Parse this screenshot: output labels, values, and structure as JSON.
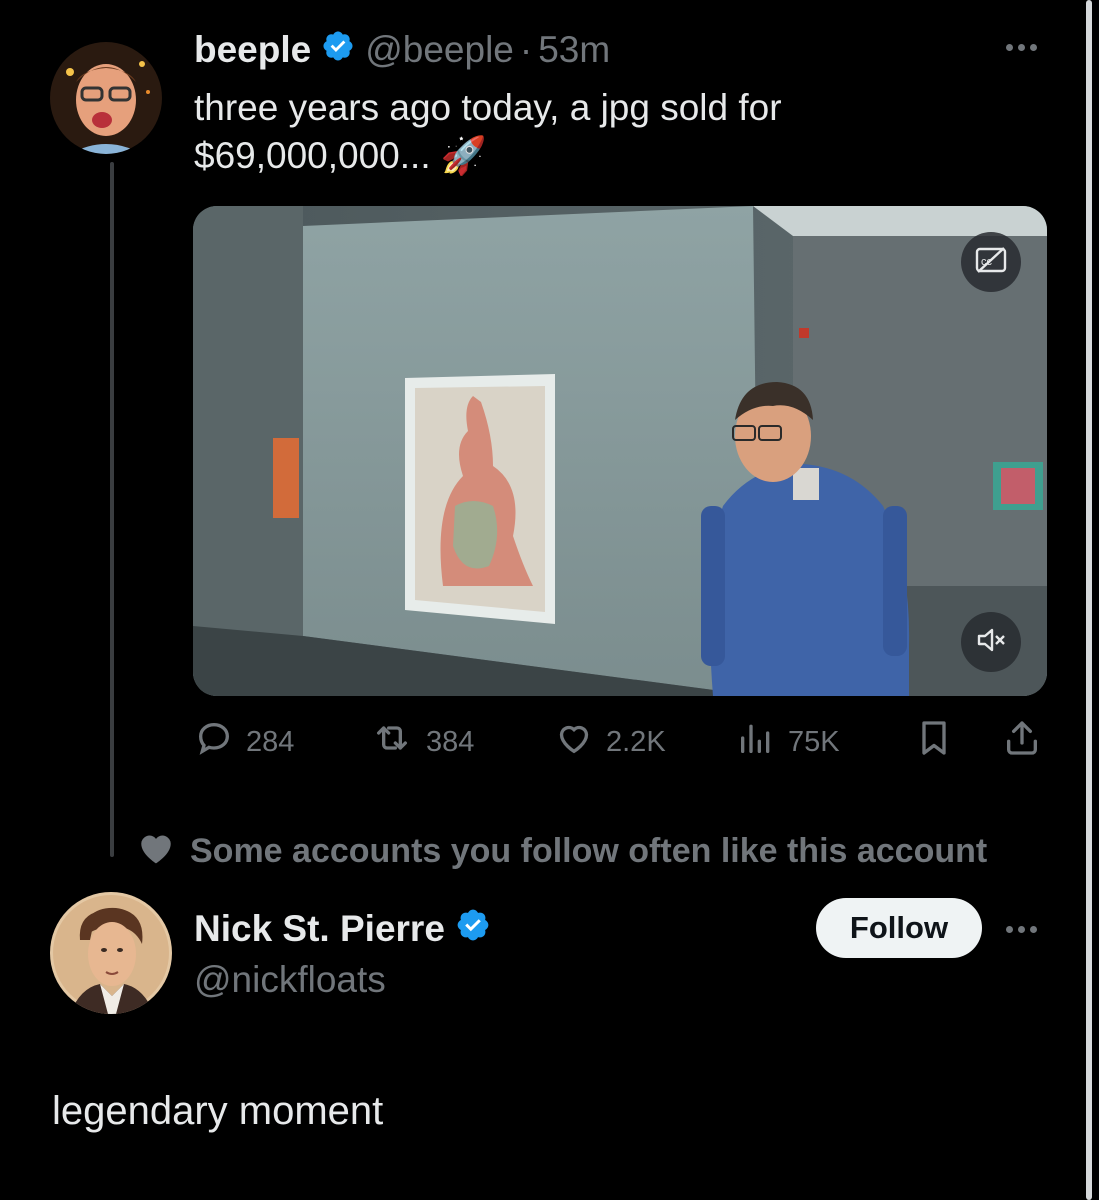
{
  "tweet": {
    "author_name": "beeple",
    "author_handle": "@beeple",
    "separator": "·",
    "time": "53m",
    "text_line1": "three years ago today, a jpg sold for",
    "text_line2": "$69,000,000... 🚀",
    "media": {
      "type": "video",
      "muted": true,
      "captions_icon": "cc-icon"
    },
    "actions": {
      "replies": "284",
      "reposts": "384",
      "likes": "2.2K",
      "views": "75K"
    }
  },
  "social_context": "Some accounts you follow often like this account",
  "suggested_account": {
    "name": "Nick St. Pierre",
    "handle": "@nickfloats",
    "follow_label": "Follow"
  },
  "reply_text": "legendary moment",
  "colors": {
    "background": "#000000",
    "text": "#e7e9ea",
    "muted": "#71767b",
    "verified": "#1d9bf0",
    "follow_bg": "#eff3f4"
  }
}
